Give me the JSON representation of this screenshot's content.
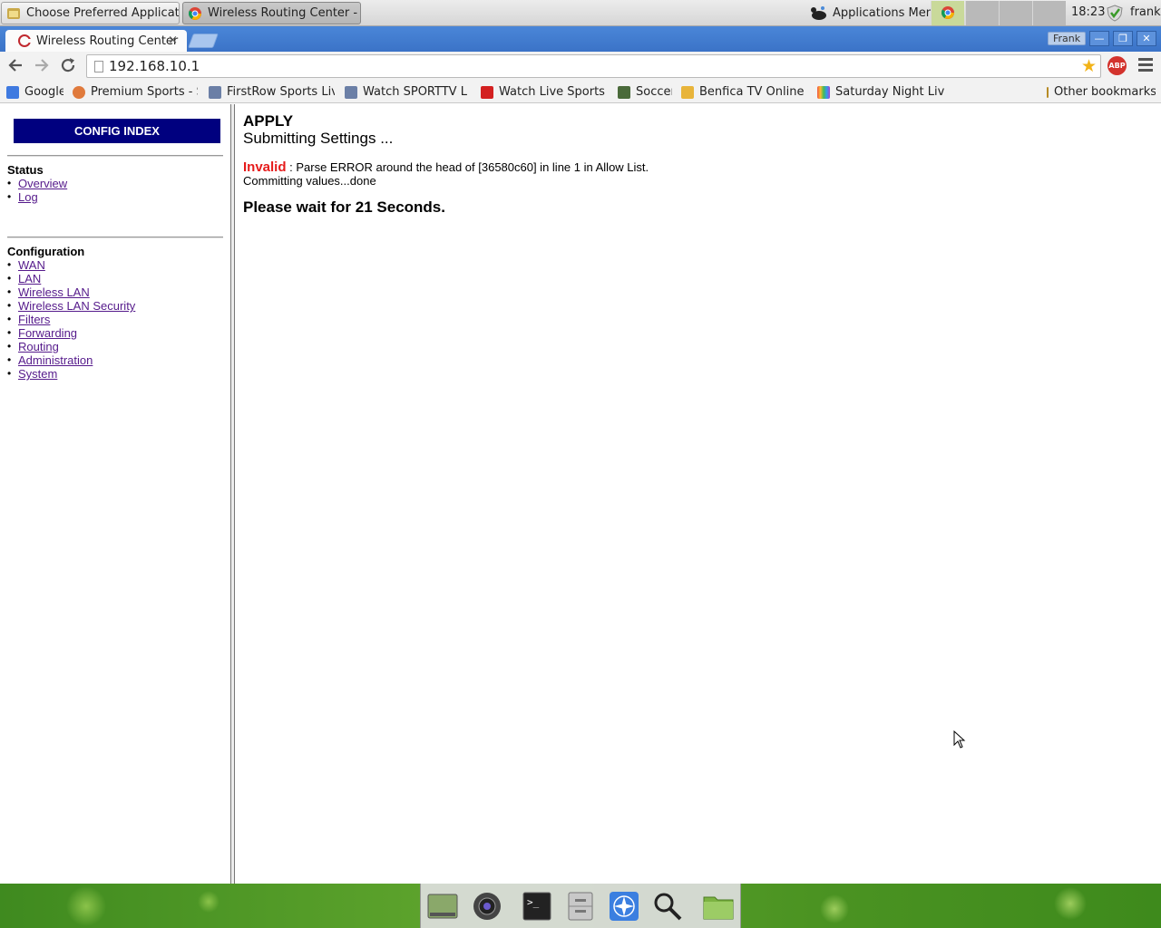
{
  "panel": {
    "tasks": [
      {
        "label": "Choose Preferred Application"
      },
      {
        "label": "Wireless Routing Center - G..."
      }
    ],
    "app_menu_label": "Applications Menu",
    "clock": "18:23",
    "user": "frank"
  },
  "browser": {
    "tab_title": "Wireless Routing Center",
    "tab_close": "×",
    "profile_name": "Frank",
    "window_buttons": {
      "minimize": "—",
      "restore": "❐",
      "close": "✕"
    },
    "url": "192.168.10.1",
    "abp_label": "ABP",
    "bookmarks": [
      {
        "label": "Google"
      },
      {
        "label": "Premium Sports - Sp"
      },
      {
        "label": "FirstRow Sports Live F"
      },
      {
        "label": "Watch SPORTTV Live"
      },
      {
        "label": "Watch Live Sports Ev"
      },
      {
        "label": "Soccer"
      },
      {
        "label": "Benfica TV Online em"
      },
      {
        "label": "Saturday Night Live |"
      }
    ],
    "other_bookmarks": "Other bookmarks"
  },
  "sidebar": {
    "config_index": "CONFIG INDEX",
    "status_heading": "Status",
    "status_links": [
      "Overview",
      "Log"
    ],
    "config_heading": "Configuration",
    "config_links": [
      "WAN",
      "LAN",
      "Wireless LAN",
      "Wireless LAN Security",
      "Filters",
      "Forwarding",
      "Routing",
      "Administration",
      "System"
    ]
  },
  "main": {
    "title": "APPLY",
    "subtitle": "Submitting Settings ...",
    "invalid_label": "Invalid",
    "error_message": " : Parse ERROR around the head of [36580c60] in line 1 in Allow List.",
    "committing": "Committing values...done",
    "wait_message": "Please wait for 21 Seconds."
  },
  "dock": {
    "icons": [
      "desktop-icon",
      "camera-icon",
      "terminal-icon",
      "file-cabinet-icon",
      "web-browser-icon",
      "search-icon",
      "folder-icon"
    ]
  }
}
